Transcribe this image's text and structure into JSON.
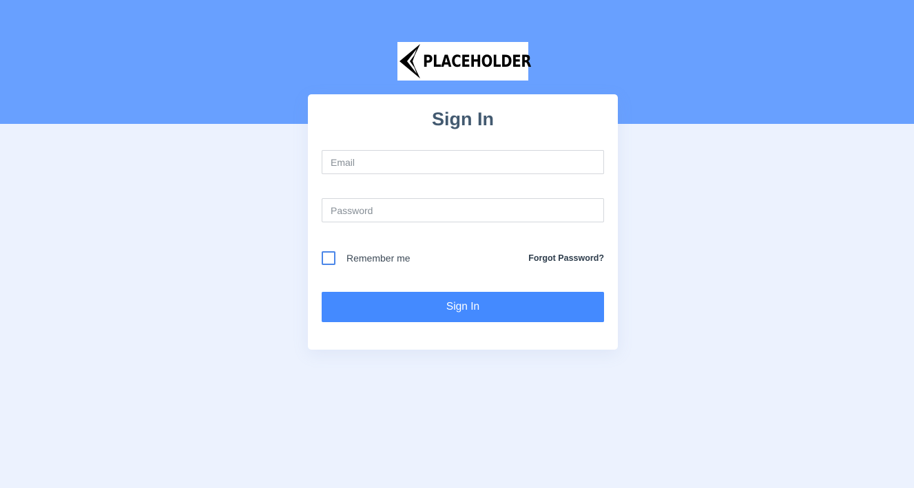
{
  "colors": {
    "header_band": "#68a0ff",
    "page_background": "#ecf2fe",
    "primary_button": "#448aff",
    "checkbox_border": "#4a86e8",
    "title_text": "#435a70"
  },
  "logo": {
    "text": "PLACEHOLDER",
    "icon": "paper-plane-arrow-icon"
  },
  "form": {
    "title": "Sign In",
    "email_placeholder": "Email",
    "email_value": "",
    "password_placeholder": "Password",
    "password_value": "",
    "remember_label": "Remember me",
    "remember_checked": false,
    "forgot_link": "Forgot Password?",
    "submit_label": "Sign In"
  }
}
